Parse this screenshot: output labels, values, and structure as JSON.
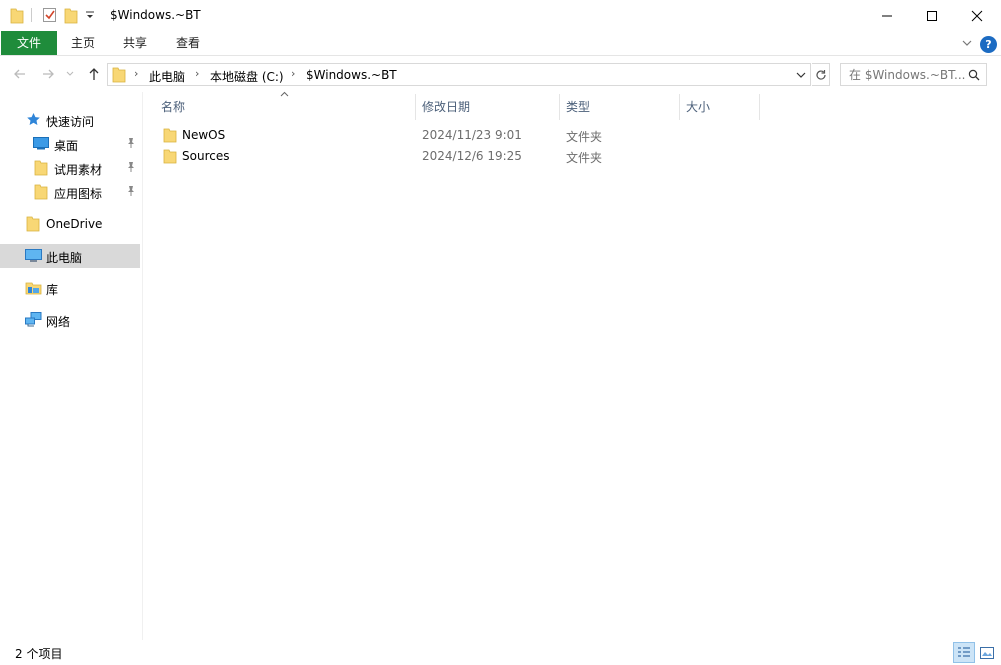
{
  "window": {
    "title": "$Windows.~BT"
  },
  "ribbon": {
    "tabs": [
      {
        "label": "文件"
      },
      {
        "label": "主页"
      },
      {
        "label": "共享"
      },
      {
        "label": "查看"
      }
    ],
    "help_label": "?"
  },
  "address": {
    "crumbs": [
      "此电脑",
      "本地磁盘 (C:)",
      "$Windows.~BT"
    ],
    "separator": "›"
  },
  "search": {
    "placeholder": "在 $Windows.~BT..."
  },
  "nav": {
    "quick_access": "快速访问",
    "quick_items": [
      {
        "label": "桌面"
      },
      {
        "label": "试用素材"
      },
      {
        "label": "应用图标"
      }
    ],
    "onedrive": "OneDrive",
    "this_pc": "此电脑",
    "libraries": "库",
    "network": "网络"
  },
  "columns": {
    "name": "名称",
    "modified": "修改日期",
    "type": "类型",
    "size": "大小"
  },
  "files": [
    {
      "name": "NewOS",
      "modified": "2024/11/23 9:01",
      "type": "文件夹"
    },
    {
      "name": "Sources",
      "modified": "2024/12/6 19:25",
      "type": "文件夹"
    }
  ],
  "status": {
    "item_count": "2 个项目"
  },
  "colors": {
    "file_tab": "#1f8c3b",
    "folder": "#f8d775",
    "selection": "#d9d9d9",
    "header_text": "#4c607a"
  },
  "icons": {
    "folder": "folder-icon",
    "properties": "checkmark-icon",
    "pin": "pin-icon",
    "star": "star-icon",
    "pc": "computer-icon",
    "network": "network-icon",
    "library": "library-icon"
  }
}
